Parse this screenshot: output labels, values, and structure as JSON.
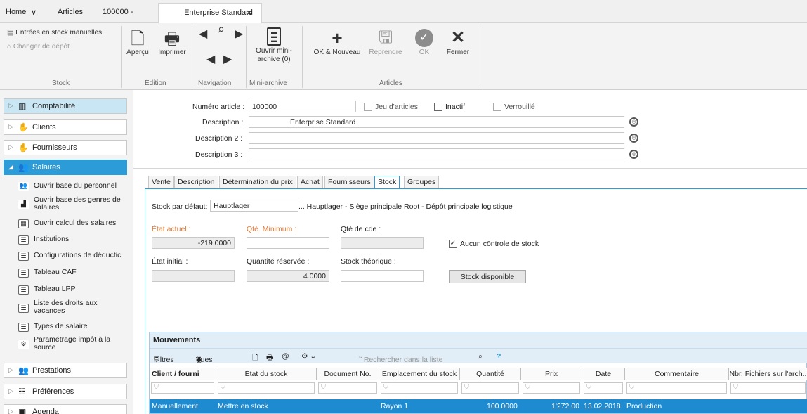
{
  "tabs": {
    "home": "Home",
    "home_chev": "∨",
    "articles": "Articles",
    "doc_id": "100000 -",
    "doc_title": "Enterprise Standard",
    "close": "✕"
  },
  "ribbon": {
    "stock_items": [
      "Entrées en stock manuelles",
      "Changer de dépôt"
    ],
    "apercu": "Aperçu",
    "imprimer": "Imprimer",
    "mini_archive": "Ouvrir mini-archive (0)",
    "ok_nouveau": "OK & Nouveau",
    "reprendre": "Reprendre",
    "ok": "OK",
    "fermer": "Fermer",
    "groups": {
      "stock": "Stock",
      "edition": "Édition",
      "navigation": "Navigation",
      "mini_archive": "Mini-archive",
      "articles": "Articles"
    }
  },
  "sidebar": {
    "comptabilite": "Comptabilité",
    "clients": "Clients",
    "fournisseurs": "Fournisseurs",
    "salaires": "Salaires",
    "sub": [
      "Ouvrir base du personnel",
      "Ouvrir base des genres de salaires",
      "Ouvrir calcul des salaires",
      "Institutions",
      "Configurations de déductic",
      "Tableau CAF",
      "Tableau LPP",
      "Liste des droits aux vacances",
      "Types de salaire",
      "Paramétrage impôt à la source"
    ],
    "prestations": "Prestations",
    "preferences": "Préférences",
    "agenda": "Agenda"
  },
  "header": {
    "numero_label": "Numéro article :",
    "numero_value": "100000",
    "jeu_label": "Jeu d'articles",
    "inactif_label": "Inactif",
    "verrouille_label": "Verrouillé",
    "desc_label": "Description :",
    "desc_value": "Enterprise Standard",
    "desc2_label": "Description 2 :",
    "desc3_label": "Description 3 :"
  },
  "form_tabs": [
    "Vente",
    "Description",
    "Détermination du prix",
    "Achat",
    "Fournisseurs",
    "Stock",
    "Groupes"
  ],
  "stock": {
    "defaut_label": "Stock par défaut:",
    "defaut_value": "Hauptlager",
    "defaut_desc": "... Hauptlager - Siège principale Root - Dépôt principale logistique",
    "etat_actuel_label": "État actuel :",
    "etat_actuel_value": "-219.0000",
    "qte_min_label": "Qté. Minimum :",
    "qte_cde_label": "Qté de cde :",
    "aucun_controle_label": "Aucun cōntrole de stock",
    "etat_initial_label": "État initial :",
    "qte_reservee_label": "Quantité réservée :",
    "qte_reservee_value": "4.0000",
    "stock_theorique_label": "Stock théorique :",
    "stock_disponible_btn": "Stock disponible"
  },
  "mouvements": {
    "title": "Mouvements",
    "filtres": "Filtres",
    "vues": "Vues",
    "search_placeholder": "Rechercher dans la liste",
    "help": "?",
    "columns": [
      "Client / fourni",
      "État du stock",
      "Document No.",
      "Emplacement du stock",
      "Quantité",
      "Prix",
      "Date",
      "Commentaire",
      "Nbr. Fichiers sur l'arch.."
    ],
    "row": [
      "Manuellement",
      "Mettre en stock",
      "",
      "Rayon 1",
      "100.0000",
      "1'272.00",
      "13.02.2018",
      "Production",
      ""
    ]
  }
}
